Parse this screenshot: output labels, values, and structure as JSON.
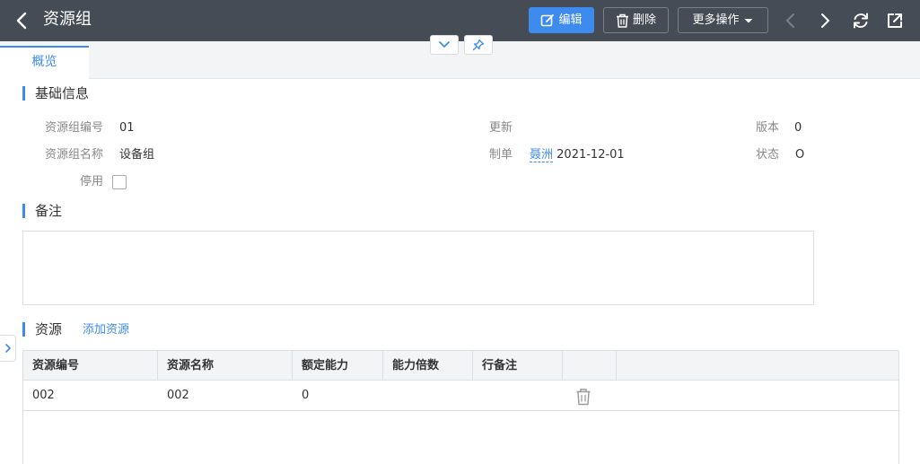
{
  "header": {
    "title": "资源组",
    "edit_label": "编辑",
    "delete_label": "删除",
    "more_label": "更多操作"
  },
  "tabs": [
    {
      "label": "概览"
    }
  ],
  "basic_info": {
    "section_title": "基础信息",
    "code_label": "资源组编号",
    "code_value": "01",
    "name_label": "资源组名称",
    "name_value": "设备组",
    "disabled_label": "停用",
    "updated_label": "更新",
    "creator_label": "制单",
    "creator_name": "聂洲",
    "creator_date": "2021-12-01",
    "version_label": "版本",
    "version_value": "0",
    "status_label": "状态",
    "status_value": "O"
  },
  "remark": {
    "section_title": "备注",
    "value": ""
  },
  "resources": {
    "section_title": "资源",
    "add_label": "添加资源",
    "columns": [
      "资源编号",
      "资源名称",
      "额定能力",
      "能力倍数",
      "行备注"
    ],
    "rows": [
      {
        "code": "002",
        "name": "002",
        "capacity": "0",
        "multiplier": "",
        "remark": ""
      }
    ]
  },
  "colors": {
    "accent": "#3d8bef",
    "topbar": "#464c55"
  }
}
